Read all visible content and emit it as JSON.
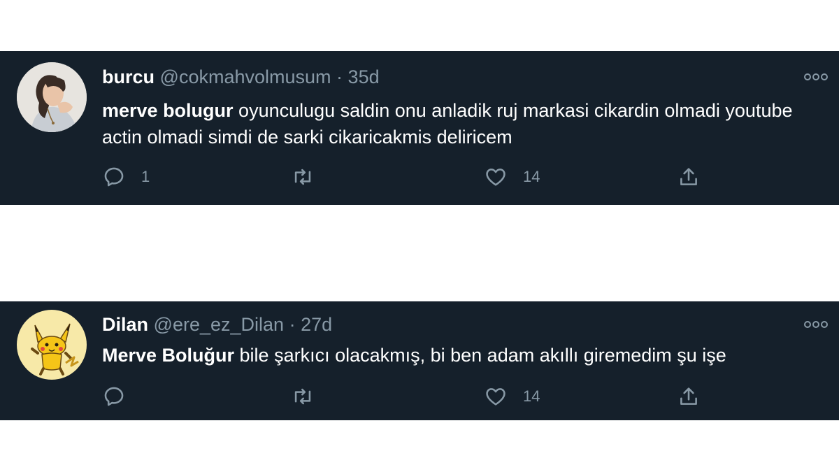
{
  "tweets": [
    {
      "name": "burcu",
      "handle": "@cokmahvolmusum",
      "separator": "·",
      "time": "35d",
      "mention": "merve bolugur",
      "text": " oyunculugu saldin onu anladik ruj markasi cikardin olmadi youtube actin olmadi simdi de sarki cikaricakmis deliricem",
      "reply_count": "1",
      "retweet_count": "",
      "like_count": "14",
      "avatar": "photo-avatar-icon"
    },
    {
      "name": "Dilan",
      "handle": "@ere_ez_Dilan",
      "separator": "·",
      "time": "27d",
      "mention": "Merve Boluğur",
      "text": " bile şarkıcı olacakmış, bi ben adam akıllı giremedim şu işe",
      "reply_count": "",
      "retweet_count": "",
      "like_count": "14",
      "avatar": "pikachu-avatar-icon"
    }
  ],
  "colors": {
    "background": "#15202b",
    "text": "#ffffff",
    "secondary": "#8899a6",
    "page": "#ffffff"
  }
}
